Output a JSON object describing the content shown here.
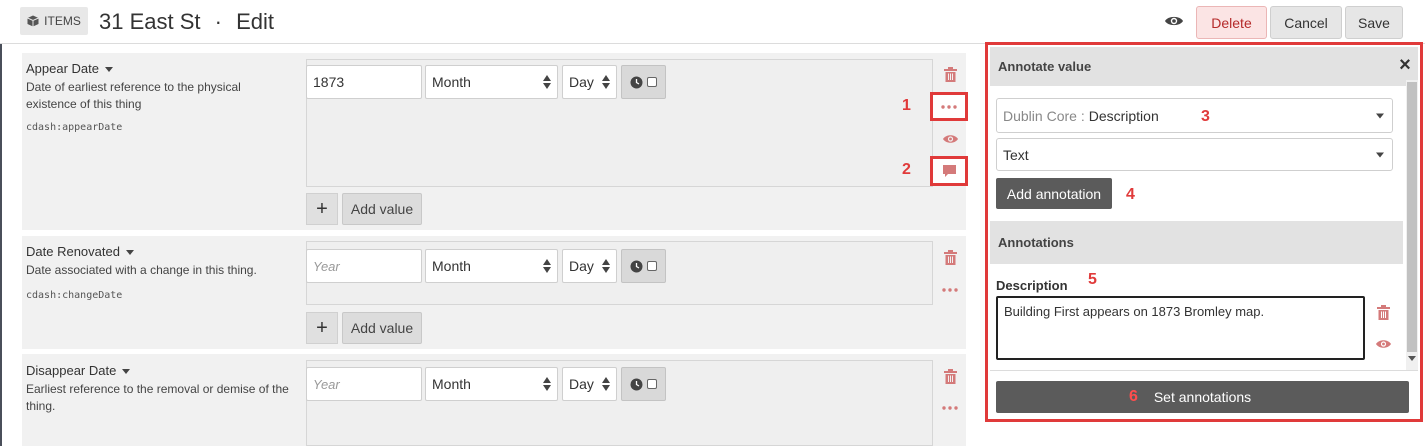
{
  "header": {
    "badge_label": "ITEMS",
    "title": "31 East St",
    "separator": "·",
    "mode": "Edit",
    "buttons": {
      "delete": "Delete",
      "cancel": "Cancel",
      "save": "Save"
    }
  },
  "properties": [
    {
      "label": "Appear Date",
      "description": "Date of earliest reference to the physical existence of this thing",
      "term": "cdash:appearDate",
      "year_value": "1873",
      "month_value": "Month",
      "day_value": "Day"
    },
    {
      "label": "Date Renovated",
      "description": "Date associated with a change in this thing.",
      "term": "cdash:changeDate",
      "year_placeholder": "Year",
      "month_value": "Month",
      "day_value": "Day"
    },
    {
      "label": "Disappear Date",
      "description": "Earliest reference to the removal or demise of the thing.",
      "year_placeholder": "Year",
      "month_value": "Month",
      "day_value": "Day"
    }
  ],
  "add_value_label": "Add value",
  "plus_symbol": "+",
  "callouts": [
    "1",
    "2",
    "3",
    "4",
    "5",
    "6"
  ],
  "annotate_panel": {
    "title": "Annotate value",
    "close_symbol": "×",
    "property_select": {
      "vocab": "Dublin Core :",
      "term": "Description"
    },
    "type_select": "Text",
    "add_button": "Add annotation",
    "annotations_header": "Annotations",
    "annotation_label": "Description",
    "annotation_text": "Building First appears on 1873 Bromley map.",
    "set_button": "Set annotations"
  },
  "colors": {
    "highlight": "#e03a3a",
    "delete_text": "#b52a2a",
    "dark_button": "#5b5b5b",
    "icon_red": "#d47a7a"
  }
}
